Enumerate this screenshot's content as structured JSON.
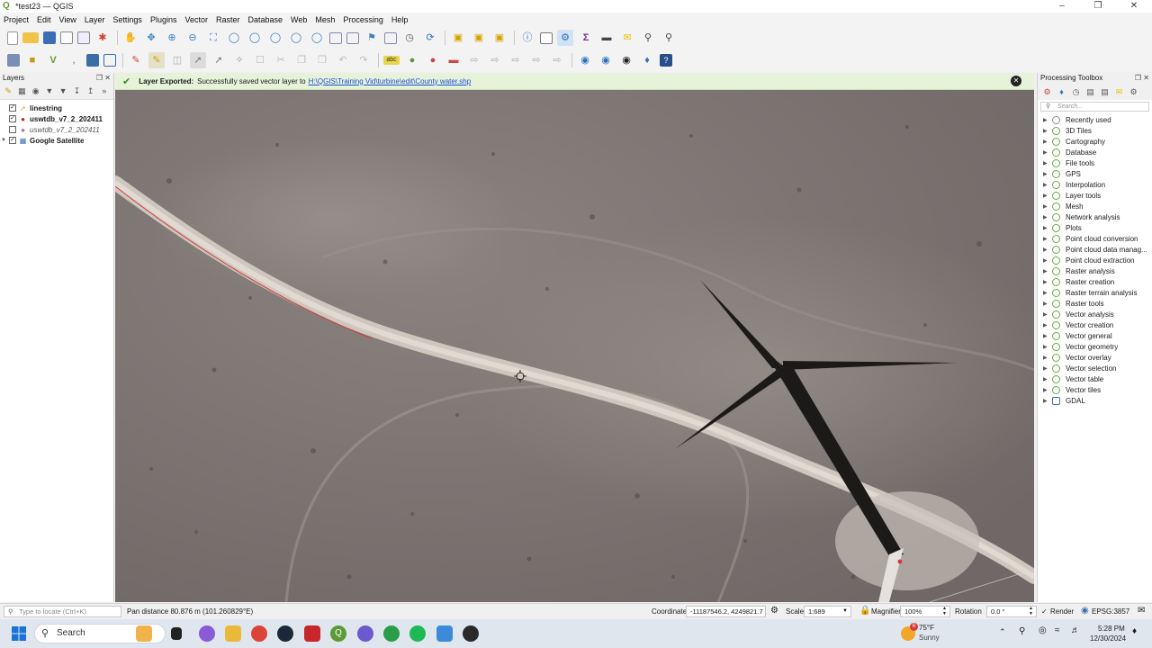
{
  "window": {
    "title": "*test23 — QGIS",
    "app_icon": "qgis-icon"
  },
  "menu": [
    "Project",
    "Edit",
    "View",
    "Layer",
    "Settings",
    "Plugins",
    "Vector",
    "Raster",
    "Database",
    "Web",
    "Mesh",
    "Processing",
    "Help"
  ],
  "message_bar": {
    "title": "Layer Exported:",
    "text": "Successfully saved vector layer to",
    "link": "H:\\QGIS\\Training Vid\\turbine\\edit\\County water.shp"
  },
  "layers_panel": {
    "title": "Layers",
    "layers": [
      {
        "name": "linestring",
        "checked": true,
        "bold": true,
        "icon": "line-layer-icon"
      },
      {
        "name": "uswtdb_v7_2_202411",
        "checked": true,
        "bold": true,
        "icon": "point-layer-icon"
      },
      {
        "name": "uswtdb_v7_2_202411",
        "checked": false,
        "bold": false,
        "italic": true,
        "icon": "point-layer-icon"
      },
      {
        "name": "Google Satellite",
        "checked": true,
        "bold": true,
        "icon": "raster-layer-icon"
      }
    ]
  },
  "processing_toolbox": {
    "title": "Processing Toolbox",
    "search_placeholder": "Search...",
    "items": [
      "Recently used",
      "3D Tiles",
      "Cartography",
      "Database",
      "File tools",
      "GPS",
      "Interpolation",
      "Layer tools",
      "Mesh",
      "Network analysis",
      "Plots",
      "Point cloud conversion",
      "Point cloud data manag...",
      "Point cloud extraction",
      "Raster analysis",
      "Raster creation",
      "Raster terrain analysis",
      "Raster tools",
      "Vector analysis",
      "Vector creation",
      "Vector general",
      "Vector geometry",
      "Vector overlay",
      "Vector selection",
      "Vector table",
      "Vector tiles",
      "GDAL"
    ]
  },
  "status_bar": {
    "locator_placeholder": "Type to locate (Ctrl+K)",
    "message": "Pan distance 80.876 m (101.260829°E)",
    "coordinate_label": "Coordinate",
    "coordinate_value": "-11187546.2, 4249821.7",
    "scale_label": "Scale",
    "scale_value": "1:689",
    "magnifier_label": "Magnifier",
    "magnifier_value": "100%",
    "rotation_label": "Rotation",
    "rotation_value": "0.0 °",
    "render_label": "Render",
    "crs": "EPSG:3857"
  },
  "taskbar": {
    "search_label": "Search",
    "weather_temp": "75°F",
    "weather_desc": "Sunny",
    "weather_badge": "6",
    "time": "5:28 PM",
    "date": "12/30/2024"
  },
  "colors": {
    "qgis_green": "#5b9a35",
    "message_bg": "#e6f2d9",
    "link": "#1b4fd6",
    "linestring": "#d23b3b",
    "ground": "#7c7572",
    "road": "#cfc7be"
  }
}
